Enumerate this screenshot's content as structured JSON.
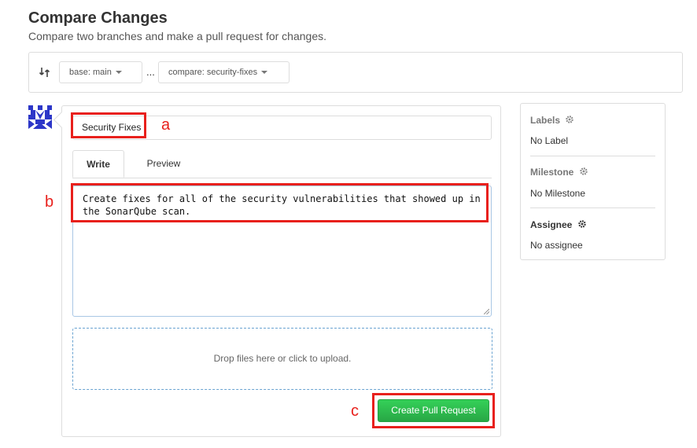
{
  "header": {
    "title": "Compare Changes",
    "subtitle": "Compare two branches and make a pull request for changes."
  },
  "branches": {
    "base_label": "base: main",
    "separator": "...",
    "compare_label": "compare: security-fixes"
  },
  "pr_form": {
    "title_value": "Security Fixes",
    "tabs": [
      {
        "label": "Write",
        "active": true
      },
      {
        "label": "Preview",
        "active": false
      }
    ],
    "body_value": "Create fixes for all of the security vulnerabilities that showed up in the SonarQube scan.",
    "drop_text": "Drop files here or click to upload.",
    "create_button": "Create Pull Request"
  },
  "sidebar": {
    "labels": {
      "heading": "Labels",
      "value": "No Label"
    },
    "milestone": {
      "heading": "Milestone",
      "value": "No Milestone"
    },
    "assignee": {
      "heading": "Assignee",
      "value": "No assignee"
    }
  },
  "annotations": {
    "a": "a",
    "b": "b",
    "c": "c"
  },
  "colors": {
    "accent_green": "#2cbe4e",
    "annotation_red": "#e8201c"
  },
  "icons": [
    "swap-icon",
    "caret-down-icon",
    "avatar-icon",
    "gear-icon"
  ]
}
